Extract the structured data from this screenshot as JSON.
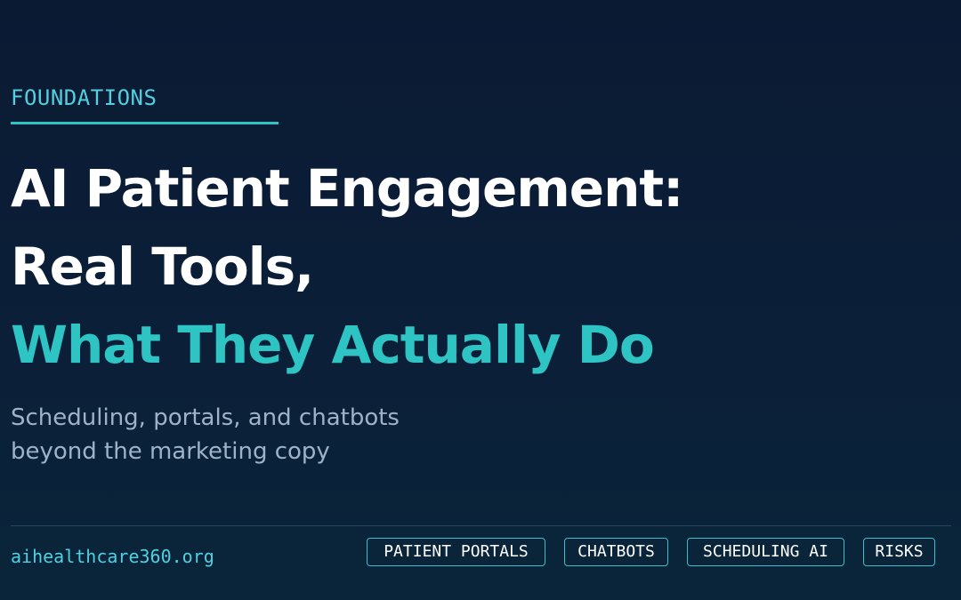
{
  "header": {
    "kicker": "FOUNDATIONS"
  },
  "title": {
    "line1": "AI Patient Engagement:",
    "line2": "Real Tools,",
    "line3": "What They Actually Do"
  },
  "subtitle": {
    "line1": "Scheduling, portals, and chatbots",
    "line2": "beyond the marketing copy"
  },
  "footer": {
    "site": "aihealthcare360.org",
    "tags": [
      "PATIENT PORTALS",
      "CHATBOTS",
      "SCHEDULING AI",
      "RISKS"
    ]
  },
  "colors": {
    "background": "#0b1a33",
    "accent": "#2ec4c4",
    "kicker_text": "#52cfe0",
    "title_text": "#ffffff",
    "subtitle_text": "#9fb3c8"
  }
}
